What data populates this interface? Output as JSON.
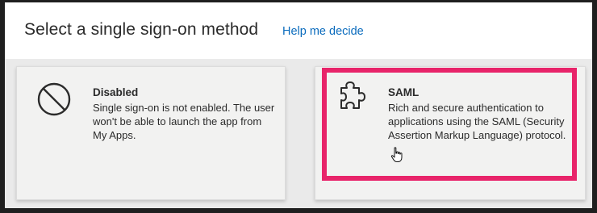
{
  "header": {
    "title": "Select a single sign-on method",
    "help_link": "Help me decide"
  },
  "cards": [
    {
      "title": "Disabled",
      "description": "Single sign-on is not enabled. The user won't be able to launch the app from My Apps.",
      "icon": "prohibited-icon"
    },
    {
      "title": "SAML",
      "description": "Rich and secure authentication to applications using the SAML (Security Assertion Markup Language) protocol.",
      "icon": "puzzle-piece-icon"
    }
  ],
  "colors": {
    "link": "#0a6bbd",
    "highlight": "#e8246a",
    "card_background": "#f2f2f1",
    "content_background": "#eaeaea"
  }
}
